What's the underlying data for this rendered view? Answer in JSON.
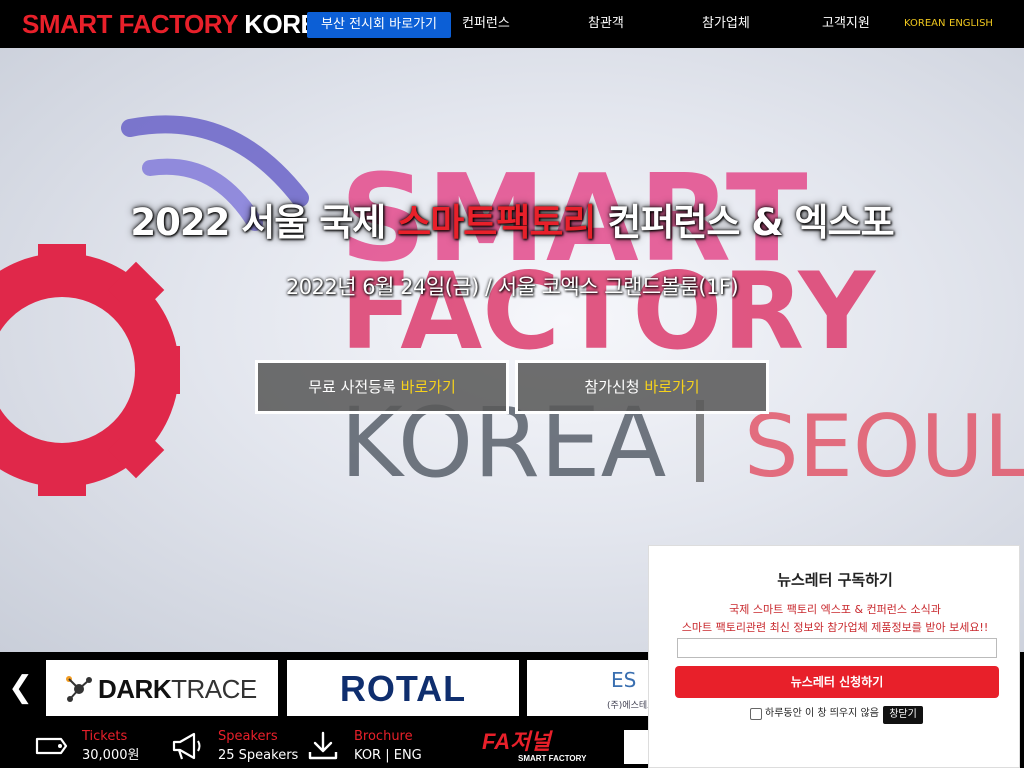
{
  "header": {
    "logo_part1": "SMART FACTORY",
    "logo_part2": "KOREA",
    "busan_button": "부산 전시회 바로가기",
    "nav": [
      "컨퍼런스",
      "참관객",
      "참가업체",
      "고객지원"
    ],
    "lang_korean": "KOREAN",
    "lang_english": "ENGLISH"
  },
  "hero": {
    "title_before": "2022 서울 국제 ",
    "title_accent": "스마트팩토리",
    "title_after": " 컨퍼런스 & 엑스포",
    "subtitle": "2022년 6월 24일(금) / 서울 코엑스 그랜드볼룸(1F)",
    "cta1_label": "무료 사전등록 ",
    "cta1_go": "바로가기",
    "cta2_label": "참가신청 ",
    "cta2_go": "바로가기",
    "background_text": {
      "line1": "SMART",
      "line2": "FACTORY",
      "line3": "KOREA",
      "line4": "SEOUL"
    }
  },
  "sponsors": {
    "prev_arrow": "❮",
    "darktrace_part1": "DARK",
    "darktrace_part2": "TRACE",
    "rotal": "ROTAL",
    "es_mark": "ES",
    "es_name": "(주)에스테크"
  },
  "infobar": {
    "tickets_label": "Tickets",
    "tickets_value": "30,000원",
    "speakers_label": "Speakers",
    "speakers_value": "25 Speakers",
    "brochure_label": "Brochure",
    "brochure_value": "KOR | ENG",
    "fa_logo": "FA저널",
    "fa_sub": "SMART FACTORY"
  },
  "newsletter": {
    "title": "뉴스레터 구독하기",
    "desc_line1": "국제 스마트 팩토리 엑스포 & 컨퍼런스 소식과",
    "desc_line2": "스마트 팩토리관련 최신 정보와 참가업체 제품정보를 받아 보세요!!",
    "input_value": "",
    "subscribe_button": "뉴스레터 신청하기",
    "checkbox_label": "하루동안 이 창 띄우지 않음",
    "close_button": "창닫기"
  },
  "colors": {
    "brand_red": "#e8202a",
    "nav_blue": "#0c5fd6",
    "lang_yellow": "#f0c81e",
    "cta_yellow": "#f6d21c"
  }
}
